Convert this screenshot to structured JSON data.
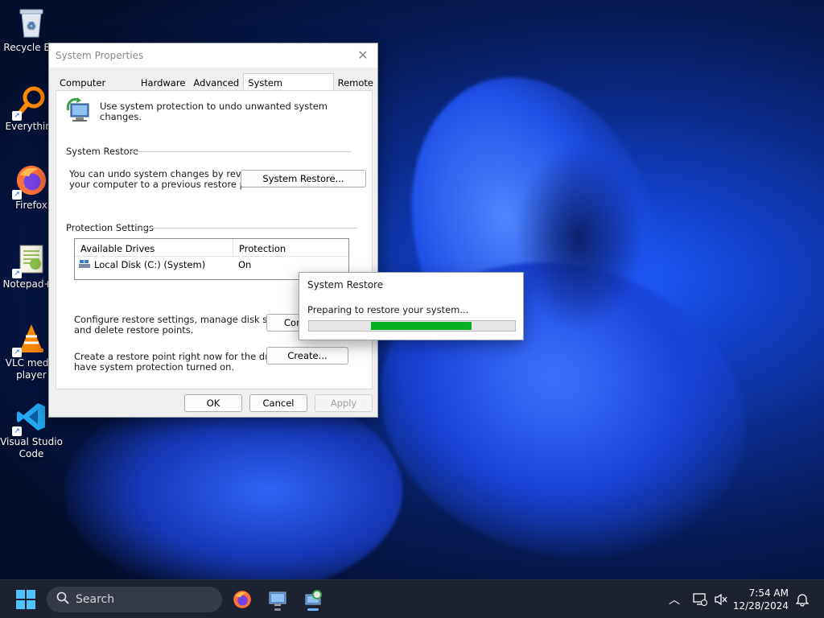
{
  "desktop": {
    "icons": [
      {
        "label": "Recycle Bin",
        "icon": "recycle-bin-icon"
      },
      {
        "label": "Everything",
        "icon": "everything-search-icon"
      },
      {
        "label": "Firefox",
        "icon": "firefox-icon"
      },
      {
        "label": "Notepad++",
        "icon": "notepad-plus-plus-icon"
      },
      {
        "label": "VLC media player",
        "icon": "vlc-icon"
      },
      {
        "label": "Visual Studio Code",
        "icon": "vscode-icon"
      }
    ]
  },
  "window": {
    "title": "System Properties",
    "close_glyph": "✕",
    "tabs": [
      {
        "label": "Computer Name",
        "active": false
      },
      {
        "label": "Hardware",
        "active": false
      },
      {
        "label": "Advanced",
        "active": false
      },
      {
        "label": "System Protection",
        "active": true
      },
      {
        "label": "Remote",
        "active": false
      }
    ],
    "intro_text": "Use system protection to undo unwanted system changes.",
    "system_restore": {
      "heading": "System Restore",
      "description_line1": "You can undo system changes by reverting",
      "description_line2": "your computer to a previous restore point.",
      "button": "System Restore..."
    },
    "protection_settings": {
      "heading": "Protection Settings",
      "columns": [
        "Available Drives",
        "Protection"
      ],
      "rows": [
        {
          "drive": "Local Disk (C:) (System)",
          "protection": "On"
        }
      ],
      "configure_text_line1": "Configure restore settings, manage disk space,",
      "configure_text_line2": "and delete restore points.",
      "configure_button": "Configure...",
      "create_text_line1": "Create a restore point right now for the drives that",
      "create_text_line2": "have system protection turned on.",
      "create_button": "Create..."
    },
    "footer": {
      "ok": "OK",
      "cancel": "Cancel",
      "apply": "Apply"
    }
  },
  "progress_dialog": {
    "title": "System Restore",
    "message": "Preparing to restore your system...",
    "indeterminate_segment_start": 0.3,
    "indeterminate_segment_end": 0.79,
    "accent_color": "#06b025"
  },
  "taskbar": {
    "search_placeholder": "Search",
    "time": "7:54 AM",
    "date": "12/28/2024",
    "apps": [
      "firefox-icon",
      "system-properties-icon",
      "system-restore-icon"
    ]
  }
}
